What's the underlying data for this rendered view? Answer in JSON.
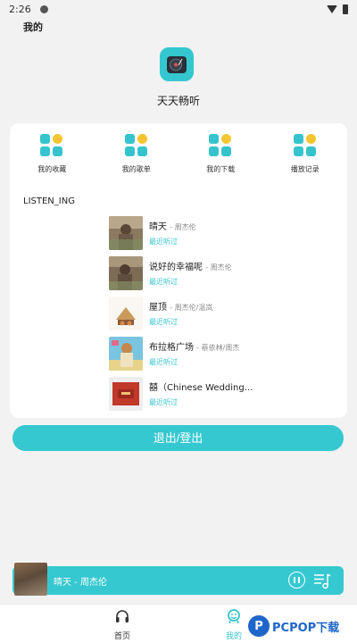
{
  "status_bar": {
    "time": "2:26"
  },
  "header": {
    "title": "我的"
  },
  "app": {
    "name": "天天畅听"
  },
  "quick_actions": [
    {
      "label": "我的收藏",
      "icon": "grid-icon"
    },
    {
      "label": "我的歌单",
      "icon": "grid-icon"
    },
    {
      "label": "我的下载",
      "icon": "grid-icon"
    },
    {
      "label": "播放记录",
      "icon": "grid-icon"
    }
  ],
  "listening": {
    "title": "LISTEN_ING",
    "songs": [
      {
        "title": "晴天",
        "artist": "周杰伦",
        "meta": "最近听过"
      },
      {
        "title": "说好的幸福呢",
        "artist": "周杰伦",
        "meta": "最近听过"
      },
      {
        "title": "屋顶",
        "artist": "周杰伦/温岚",
        "meta": "最近听过"
      },
      {
        "title": "布拉格广场",
        "artist": "蔡依林/周杰",
        "meta": "最近听过"
      },
      {
        "title": "囍（Chinese Wedding...",
        "artist": "",
        "meta": "最近听过"
      }
    ]
  },
  "logout_button": {
    "label": "退出/登出"
  },
  "mini_player": {
    "now_playing": "晴天 - 周杰伦"
  },
  "tabs": [
    {
      "label": "首页"
    },
    {
      "label": "我的"
    }
  ],
  "watermark": {
    "text": "PCPOP下载"
  },
  "colors": {
    "accent": "#36c8d0",
    "accent_yellow": "#f5c431"
  }
}
